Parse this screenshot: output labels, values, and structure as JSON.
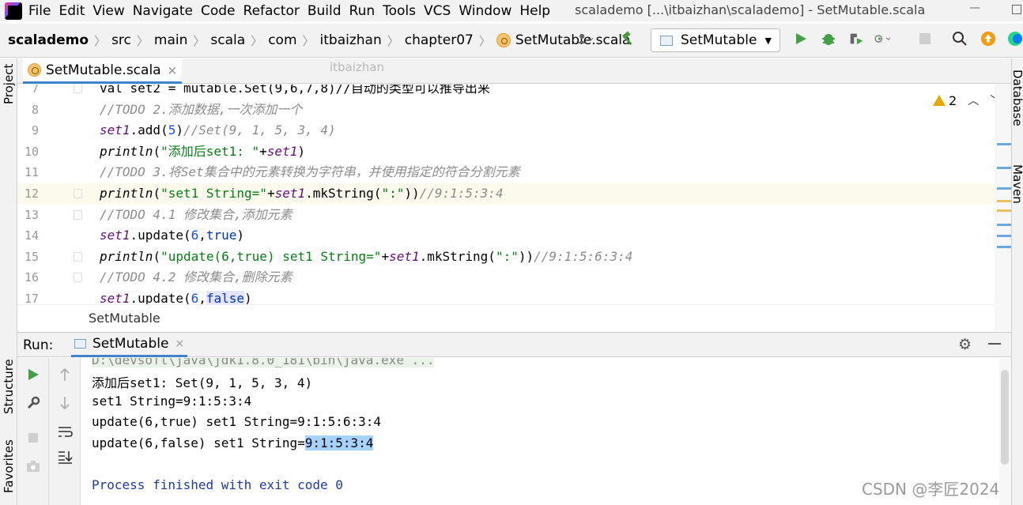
{
  "menu": {
    "items": [
      "File",
      "Edit",
      "View",
      "Navigate",
      "Code",
      "Refactor",
      "Build",
      "Run",
      "Tools",
      "VCS",
      "Window",
      "Help"
    ],
    "window_title": "scalademo [...\\itbaizhan\\scalademo] - SetMutable.scala"
  },
  "navbar": {
    "crumbs": [
      "scalademo",
      "src",
      "main",
      "scala",
      "com",
      "itbaizhan",
      "chapter07",
      "SetMutable.scala"
    ],
    "run_config": "SetMutable"
  },
  "tool_windows": {
    "left": [
      "Project",
      "Structure",
      "Favorites"
    ],
    "right": [
      "Database",
      "Maven"
    ]
  },
  "editor": {
    "tab_label": "SetMutable.scala",
    "tab_close": "×",
    "watermark": "itbaizhan",
    "warnings_count": "2",
    "breadcrumb": "SetMutable",
    "lines": [
      {
        "num": "7",
        "segments": [
          {
            "t": "val set2 = mutable.Set(9,6,7,8)//自动的类型可以推导出来",
            "c": "c-plain"
          }
        ]
      },
      {
        "num": "8",
        "segments": [
          {
            "t": "//TODO 2.添加数据,一次添加一个",
            "c": "c-comment"
          }
        ]
      },
      {
        "num": "9",
        "segments": [
          {
            "t": "set1",
            "c": "c-var"
          },
          {
            "t": ".add(",
            "c": "c-plain"
          },
          {
            "t": "5",
            "c": "c-num"
          },
          {
            "t": ")",
            "c": "c-plain"
          },
          {
            "t": "//Set(9, 1, 5, 3, 4)",
            "c": "c-comment"
          }
        ]
      },
      {
        "num": "10",
        "segments": [
          {
            "t": "println",
            "c": "c-fn"
          },
          {
            "t": "(",
            "c": "c-plain"
          },
          {
            "t": "\"添加后set1: \"",
            "c": "c-str"
          },
          {
            "t": "+",
            "c": "c-plain"
          },
          {
            "t": "set1",
            "c": "c-var"
          },
          {
            "t": ")",
            "c": "c-plain"
          }
        ]
      },
      {
        "num": "11",
        "segments": [
          {
            "t": "//TODO 3.将Set集合中的元素转换为字符串，并使用指定的符合分割元素",
            "c": "c-comment"
          }
        ]
      },
      {
        "num": "12",
        "segments": [
          {
            "t": "println",
            "c": "c-fn"
          },
          {
            "t": "(",
            "c": "c-plain"
          },
          {
            "t": "\"set1 String=\"",
            "c": "c-str"
          },
          {
            "t": "+",
            "c": "c-plain"
          },
          {
            "t": "set1",
            "c": "c-var"
          },
          {
            "t": ".mkString(",
            "c": "c-plain"
          },
          {
            "t": "\":\"",
            "c": "c-str"
          },
          {
            "t": "))",
            "c": "c-plain"
          },
          {
            "t": "//9:1:5:3:4",
            "c": "c-comment"
          }
        ]
      },
      {
        "num": "13",
        "segments": [
          {
            "t": "//TODO 4.1 修改集合,添加元素",
            "c": "c-comment"
          }
        ]
      },
      {
        "num": "14",
        "segments": [
          {
            "t": "set1",
            "c": "c-var"
          },
          {
            "t": ".update(",
            "c": "c-plain"
          },
          {
            "t": "6",
            "c": "c-num"
          },
          {
            "t": ",",
            "c": "c-plain"
          },
          {
            "t": "true",
            "c": "c-kw"
          },
          {
            "t": ")",
            "c": "c-plain"
          }
        ]
      },
      {
        "num": "15",
        "segments": [
          {
            "t": "println",
            "c": "c-fn"
          },
          {
            "t": "(",
            "c": "c-plain"
          },
          {
            "t": "\"update(6,true) set1 String=\"",
            "c": "c-str"
          },
          {
            "t": "+",
            "c": "c-plain"
          },
          {
            "t": "set1",
            "c": "c-var"
          },
          {
            "t": ".mkString(",
            "c": "c-plain"
          },
          {
            "t": "\":\"",
            "c": "c-str"
          },
          {
            "t": "))",
            "c": "c-plain"
          },
          {
            "t": "//9:1:5:6:3:4",
            "c": "c-comment"
          }
        ]
      },
      {
        "num": "16",
        "segments": [
          {
            "t": "//TODO 4.2 修改集合,删除元素",
            "c": "c-comment"
          }
        ]
      },
      {
        "num": "17",
        "segments": [
          {
            "t": "set1",
            "c": "c-var"
          },
          {
            "t": ".update(",
            "c": "c-plain"
          },
          {
            "t": "6",
            "c": "c-num"
          },
          {
            "t": ",",
            "c": "c-plain"
          },
          {
            "t": "false",
            "c": "c-kw c-hl"
          },
          {
            "t": ")",
            "c": "c-plain"
          }
        ]
      }
    ]
  },
  "run": {
    "label": "Run:",
    "tab_label": "SetMutable",
    "tab_close": "×",
    "output": [
      "D:\\devsoft\\java\\jdk1.8.0_181\\bin\\java.exe ...",
      "添加后set1: Set(9, 1, 5, 3, 4)",
      "set1 String=9:1:5:3:4",
      "update(6,true) set1 String=9:1:5:6:3:4",
      "update(6,false) set1 String="
    ],
    "selected_value": "9:1:5:3:4",
    "finish": "Process finished with exit code 0"
  },
  "watermark": "CSDN @李匠2024",
  "colors": {
    "accent_tab": "#4083c9",
    "comment": "#8c8c8c",
    "string": "#067d17",
    "number": "#1750eb",
    "keyword": "#0033b3",
    "variable": "#660e7a",
    "run_green": "#43a047",
    "warning": "#e6a700"
  }
}
